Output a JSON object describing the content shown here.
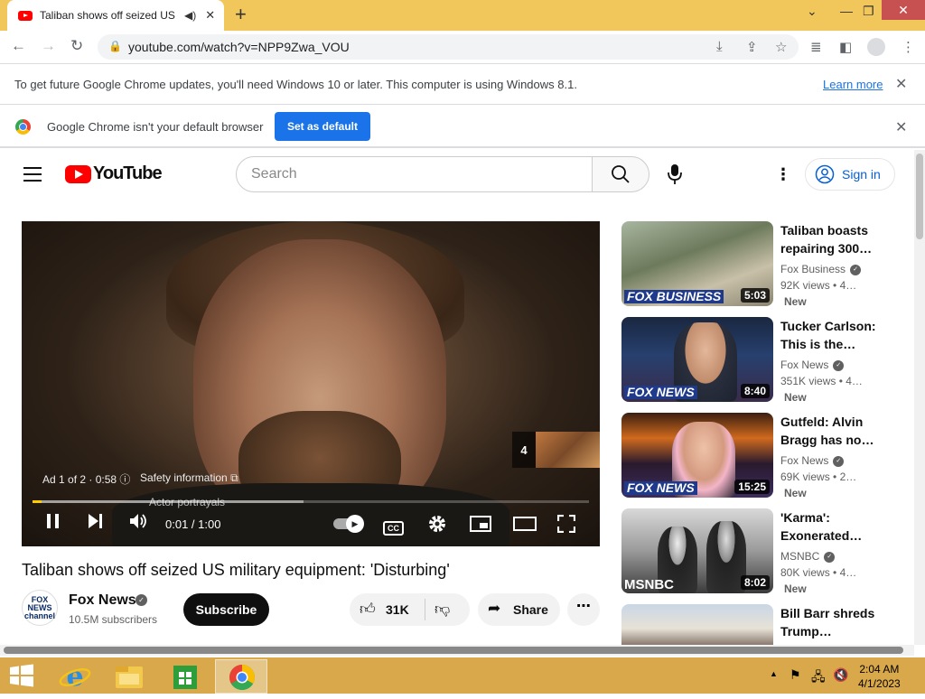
{
  "browser": {
    "tab_title": "Taliban shows off seized US",
    "url": "youtube.com/watch?v=NPP9Zwa_VOU",
    "new_tab_glyph": "+"
  },
  "infobar_update": {
    "text": "To get future Google Chrome updates, you'll need Windows 10 or later. This computer is using Windows 8.1.",
    "link": "Learn more"
  },
  "infobar_default": {
    "text": "Google Chrome isn't your default browser",
    "button": "Set as default"
  },
  "youtube": {
    "logo_text": "YouTube",
    "search_placeholder": "Search",
    "sign_in": "Sign in"
  },
  "player": {
    "ad_info": "Ad 1 of 2 · 0:58",
    "safety_info": "Safety information",
    "disclaimer": "Actor portrayals",
    "time": "0:01 / 1:00",
    "up_next_count": "4",
    "progress_fraction": 0.017,
    "cc_label": "CC"
  },
  "video": {
    "title": "Taliban shows off seized US military equipment: 'Disturbing'",
    "channel": "Fox News",
    "channel_avatar": "FOX NEWS channel",
    "subscribers": "10.5M subscribers",
    "subscribe": "Subscribe",
    "likes": "31K",
    "share": "Share"
  },
  "recommended": [
    {
      "title_1": "Taliban boasts",
      "title_2": "repairing 300…",
      "channel": "Fox Business",
      "views": "92K views",
      "age": "• 4…",
      "badge": "New",
      "duration": "5:03",
      "logo": "FOX BUSINESS"
    },
    {
      "title_1": "Tucker Carlson:",
      "title_2": "This is the…",
      "channel": "Fox News",
      "views": "351K views",
      "age": "• 4…",
      "badge": "New",
      "duration": "8:40",
      "logo": "FOX NEWS"
    },
    {
      "title_1": "Gutfeld: Alvin",
      "title_2": "Bragg has no…",
      "channel": "Fox News",
      "views": "69K views",
      "age": "• 2…",
      "badge": "New",
      "duration": "15:25",
      "logo": "FOX NEWS"
    },
    {
      "title_1": "'Karma':",
      "title_2": "Exonerated…",
      "channel": "MSNBC",
      "views": "80K views",
      "age": "• 4…",
      "badge": "New",
      "duration": "8:02",
      "logo": "MSNBC"
    },
    {
      "title_1": "Bill Barr shreds",
      "title_2": "Trump…"
    }
  ],
  "taskbar": {
    "time": "2:04 AM",
    "date": "4/1/2023"
  }
}
